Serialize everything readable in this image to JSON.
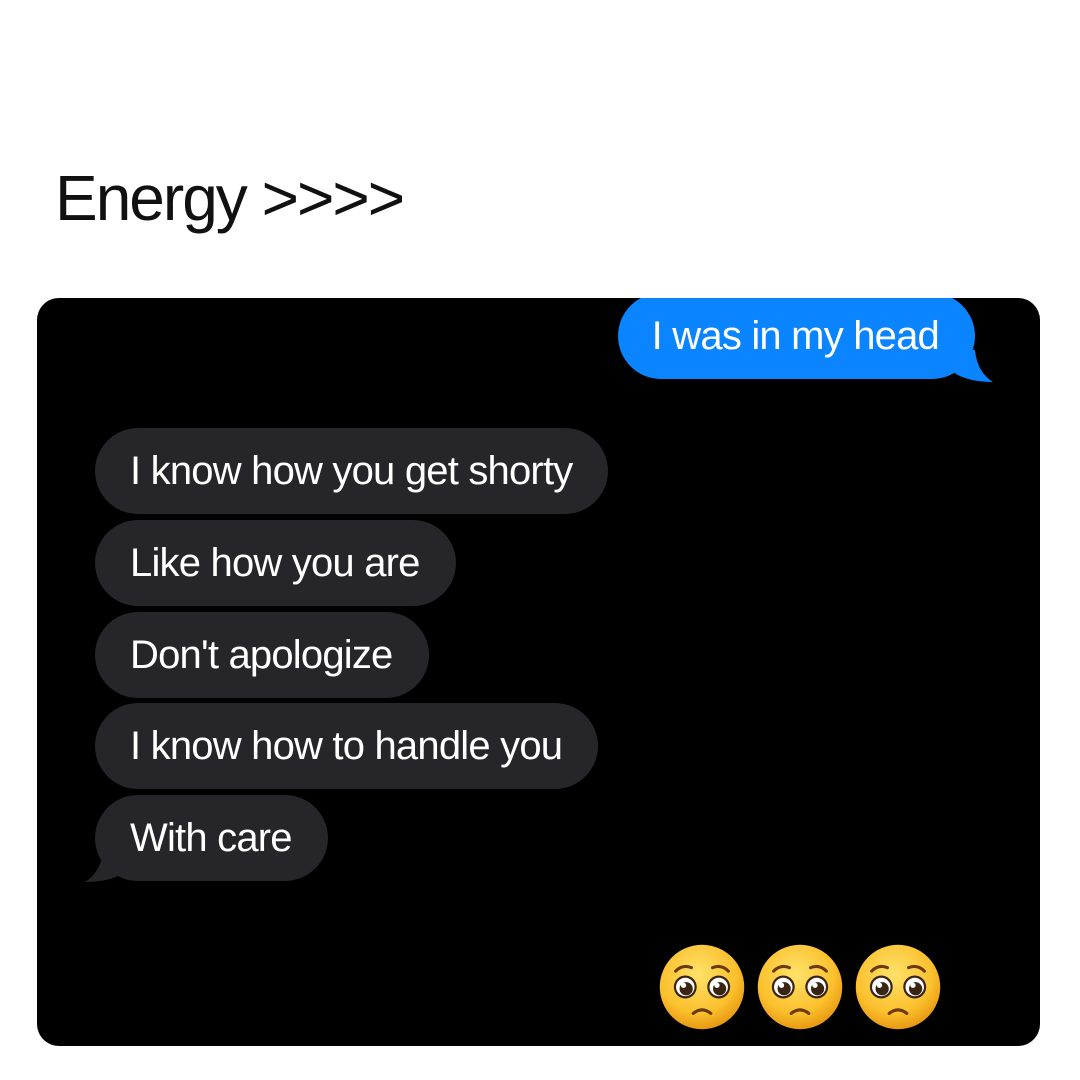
{
  "caption": "Energy >>>>",
  "conversation": {
    "sent": [
      {
        "text": "I was in my head"
      }
    ],
    "received": [
      {
        "text": "I know how you get shorty"
      },
      {
        "text": "Like how you are"
      },
      {
        "text": "Don't apologize"
      },
      {
        "text": "I know how to handle you"
      },
      {
        "text": "With care"
      }
    ],
    "reaction": {
      "emoji_name": "pleading-face-icon",
      "count": 3
    }
  },
  "colors": {
    "background": "#000000",
    "sent_bubble": "#0a84ff",
    "received_bubble": "#262529",
    "text": "#ffffff"
  }
}
